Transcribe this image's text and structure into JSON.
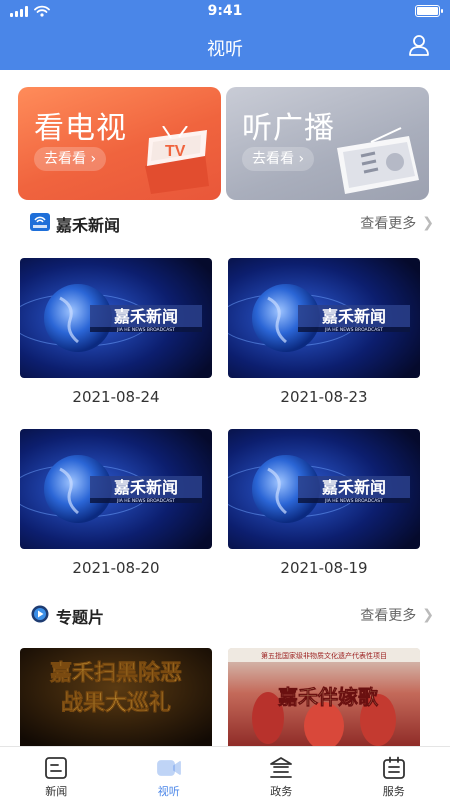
{
  "status_bar": {
    "time": "9:41"
  },
  "header": {
    "title": "视听",
    "user_icon": "user-icon"
  },
  "features": [
    {
      "title": "看电视",
      "button": "去看看",
      "icon": "tv-icon",
      "color": "#f0643e"
    },
    {
      "title": "听广播",
      "button": "去看看",
      "icon": "radio-icon",
      "color": "#a9aebc"
    }
  ],
  "news_section": {
    "title": "嘉禾新闻",
    "more": "查看更多",
    "thumb_title": "嘉禾新闻",
    "thumb_subtitle": "JIA HE NEWS BROADCAST",
    "items": [
      {
        "date": "2021-08-24"
      },
      {
        "date": "2021-08-23"
      },
      {
        "date": "2021-08-20"
      },
      {
        "date": "2021-08-19"
      }
    ]
  },
  "topic_section": {
    "title": "专题片",
    "more": "查看更多",
    "items": [
      {
        "line1": "嘉禾扫黑除恶",
        "line2": "战果大巡礼"
      },
      {
        "caption": "第五批国家级非物质文化遗产代表性项目",
        "title": "嘉禾伴嫁歌"
      }
    ]
  },
  "tabbar": {
    "items": [
      {
        "label": "新闻",
        "icon": "news-icon",
        "active": false
      },
      {
        "label": "视听",
        "icon": "video-icon",
        "active": true
      },
      {
        "label": "政务",
        "icon": "government-icon",
        "active": false
      },
      {
        "label": "服务",
        "icon": "calendar-icon",
        "active": false
      }
    ]
  },
  "colors": {
    "primary": "#4a86e8",
    "tv_card": "#f0643e",
    "radio_card": "#a9aebc"
  }
}
